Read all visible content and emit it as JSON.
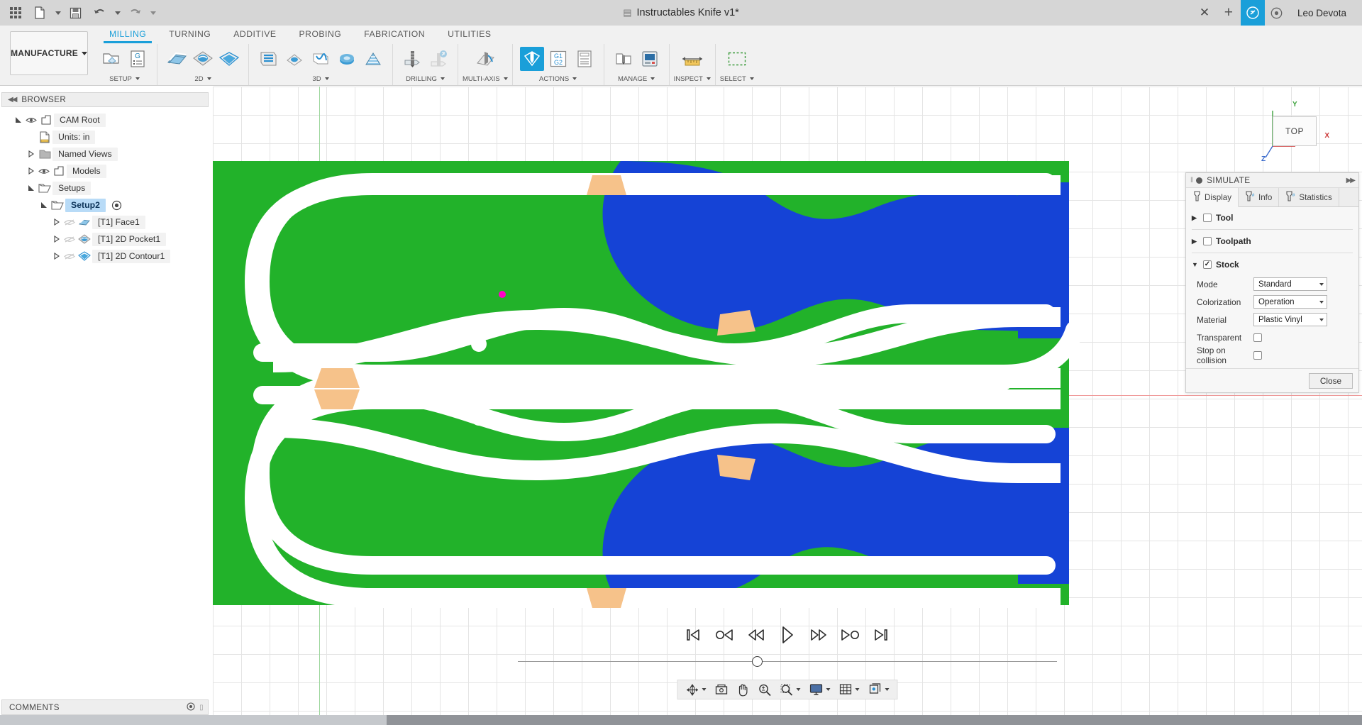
{
  "titlebar": {
    "doc_title": "Instructables Knife v1*",
    "username": "Leo Devota",
    "icons": {
      "apps": "grid-apps-icon",
      "new_doc": "new-document-icon",
      "save": "save-icon",
      "undo": "undo-icon",
      "redo": "redo-icon",
      "close": "close-icon",
      "add_tab": "add-tab-icon",
      "help": "help-icon",
      "extension": "extension-icon"
    }
  },
  "ribbon": {
    "workspace": "MANUFACTURE",
    "tabs": [
      {
        "label": "MILLING",
        "active": true
      },
      {
        "label": "TURNING",
        "active": false
      },
      {
        "label": "ADDITIVE",
        "active": false
      },
      {
        "label": "PROBING",
        "active": false
      },
      {
        "label": "FABRICATION",
        "active": false
      },
      {
        "label": "UTILITIES",
        "active": false
      }
    ],
    "panels": [
      {
        "label": "SETUP",
        "dropdown": true,
        "tools": [
          {
            "name": "setup-icon",
            "state": "normal"
          },
          {
            "name": "nc-program-icon",
            "state": "normal"
          }
        ]
      },
      {
        "label": "2D",
        "dropdown": true,
        "tools": [
          {
            "name": "face-icon",
            "state": "normal"
          },
          {
            "name": "2d-pocket-icon",
            "state": "normal"
          },
          {
            "name": "2d-contour-icon",
            "state": "normal"
          }
        ]
      },
      {
        "label": "3D",
        "dropdown": true,
        "tools": [
          {
            "name": "adaptive-clearing-icon",
            "state": "normal"
          },
          {
            "name": "pocket-clearing-icon",
            "state": "normal"
          },
          {
            "name": "parallel-icon",
            "state": "normal"
          },
          {
            "name": "scallop-icon",
            "state": "normal"
          },
          {
            "name": "spiral-icon",
            "state": "normal"
          }
        ]
      },
      {
        "label": "DRILLING",
        "dropdown": true,
        "tools": [
          {
            "name": "drill-icon",
            "state": "normal"
          },
          {
            "name": "bore-icon",
            "state": "dim"
          }
        ]
      },
      {
        "label": "MULTI-AXIS",
        "dropdown": true,
        "tools": [
          {
            "name": "swarf-icon",
            "state": "normal"
          }
        ]
      },
      {
        "label": "ACTIONS",
        "dropdown": true,
        "tools": [
          {
            "name": "simulate-icon",
            "state": "selected"
          },
          {
            "name": "post-process-g1g2-icon",
            "state": "normal"
          },
          {
            "name": "setup-sheet-icon",
            "state": "normal"
          }
        ]
      },
      {
        "label": "MANAGE",
        "dropdown": true,
        "tools": [
          {
            "name": "tool-library-icon",
            "state": "normal"
          },
          {
            "name": "machine-library-icon",
            "state": "normal"
          }
        ]
      },
      {
        "label": "INSPECT",
        "dropdown": true,
        "tools": [
          {
            "name": "measure-icon",
            "state": "normal"
          }
        ]
      },
      {
        "label": "SELECT",
        "dropdown": true,
        "tools": [
          {
            "name": "window-select-icon",
            "state": "normal"
          }
        ]
      }
    ]
  },
  "browser": {
    "header": "BROWSER",
    "collapse_icon": "collapse-left-icon",
    "tree": [
      {
        "label": "CAM Root",
        "depth": 0,
        "arrow": "open",
        "eye": true,
        "icon": "component-icon",
        "selected": false,
        "after": null
      },
      {
        "label": "Units: in",
        "depth": 1,
        "arrow": "none",
        "eye": false,
        "icon": "units-icon",
        "selected": false,
        "after": null
      },
      {
        "label": "Named Views",
        "depth": 1,
        "arrow": "closed",
        "eye": false,
        "icon": "folder-icon",
        "selected": false,
        "after": null
      },
      {
        "label": "Models",
        "depth": 1,
        "arrow": "closed",
        "eye": true,
        "icon": "component-icon",
        "selected": false,
        "after": null
      },
      {
        "label": "Setups",
        "depth": 1,
        "arrow": "open",
        "eye": false,
        "icon": "setup-folder-icon",
        "selected": false,
        "after": null
      },
      {
        "label": "Setup2",
        "depth": 2,
        "arrow": "open",
        "eye": false,
        "icon": "setup-folder-icon",
        "selected": true,
        "after": "target-icon"
      },
      {
        "label": "[T1] Face1",
        "depth": 3,
        "arrow": "closed",
        "eye": "off",
        "icon": "face-op-icon",
        "selected": false,
        "after": null
      },
      {
        "label": "[T1] 2D Pocket1",
        "depth": 3,
        "arrow": "closed",
        "eye": "off",
        "icon": "pocket-op-icon",
        "selected": false,
        "after": null
      },
      {
        "label": "[T1] 2D Contour1",
        "depth": 3,
        "arrow": "closed",
        "eye": "off",
        "icon": "contour-op-icon",
        "selected": false,
        "after": null
      }
    ],
    "comments": "COMMENTS"
  },
  "viewcube": {
    "face_label": "TOP",
    "axis_x": "X",
    "axis_y": "Y",
    "axis_z": "Z"
  },
  "simulate_panel": {
    "title": "SIMULATE",
    "grip_icon": "drag-grip-icon",
    "collapse_icon": "minimize-icon",
    "expand_icon": "expand-right-icon",
    "tabs": [
      {
        "label": "Display",
        "icon": "display-tool-icon",
        "active": true
      },
      {
        "label": "Info",
        "icon": "info-tool-icon",
        "active": false
      },
      {
        "label": "Statistics",
        "icon": "statistics-tool-icon",
        "active": false
      }
    ],
    "sections": [
      {
        "label": "Tool",
        "checked": false,
        "expanded": false
      },
      {
        "label": "Toolpath",
        "checked": false,
        "expanded": false
      },
      {
        "label": "Stock",
        "checked": true,
        "expanded": true
      }
    ],
    "stock_fields": [
      {
        "label": "Mode",
        "type": "select",
        "value": "Standard"
      },
      {
        "label": "Colorization",
        "type": "select",
        "value": "Operation"
      },
      {
        "label": "Material",
        "type": "select",
        "value": "Plastic Vinyl"
      },
      {
        "label": "Transparent",
        "type": "checkbox",
        "value": false
      },
      {
        "label": "Stop on collision",
        "type": "checkbox",
        "value": false
      }
    ],
    "close_button": "Close"
  },
  "playback": {
    "buttons": [
      {
        "name": "skip-to-start-button",
        "icon": "skip-start-icon"
      },
      {
        "name": "step-back-rapid-button",
        "icon": "step-back-circle-icon"
      },
      {
        "name": "rewind-button",
        "icon": "rewind-icon"
      },
      {
        "name": "play-button",
        "icon": "play-icon"
      },
      {
        "name": "fast-forward-button",
        "icon": "fast-forward-icon"
      },
      {
        "name": "step-forward-rapid-button",
        "icon": "step-forward-circle-icon"
      },
      {
        "name": "skip-to-end-button",
        "icon": "skip-end-icon"
      }
    ],
    "progress_percent": 44
  },
  "navbar": {
    "items": [
      {
        "name": "orbit-button",
        "icon": "orbit-icon",
        "dropdown": true
      },
      {
        "name": "look-at-button",
        "icon": "look-at-icon",
        "dropdown": false
      },
      {
        "name": "pan-button",
        "icon": "pan-hand-icon",
        "dropdown": false
      },
      {
        "name": "zoom-button",
        "icon": "zoom-icon",
        "dropdown": false
      },
      {
        "name": "fit-button",
        "icon": "zoom-window-icon",
        "dropdown": true
      },
      {
        "name": "display-settings-button",
        "icon": "monitor-icon",
        "dropdown": true
      },
      {
        "name": "grid-snaps-button",
        "icon": "grid-icon",
        "dropdown": true
      },
      {
        "name": "viewports-button",
        "icon": "viewports-icon",
        "dropdown": true
      }
    ]
  },
  "colors": {
    "accent": "#1a9fd9",
    "stock_green": "#22b22a",
    "machined_blue": "#1543d6",
    "toolpath_white": "#ffffff",
    "transition_orange": "#f6c28a",
    "tool_marker": "#ff00c8",
    "titlebar_bg": "#d6d6d6",
    "ribbon_bg": "#f1f1f1",
    "statusbar_bg": "#909398"
  }
}
